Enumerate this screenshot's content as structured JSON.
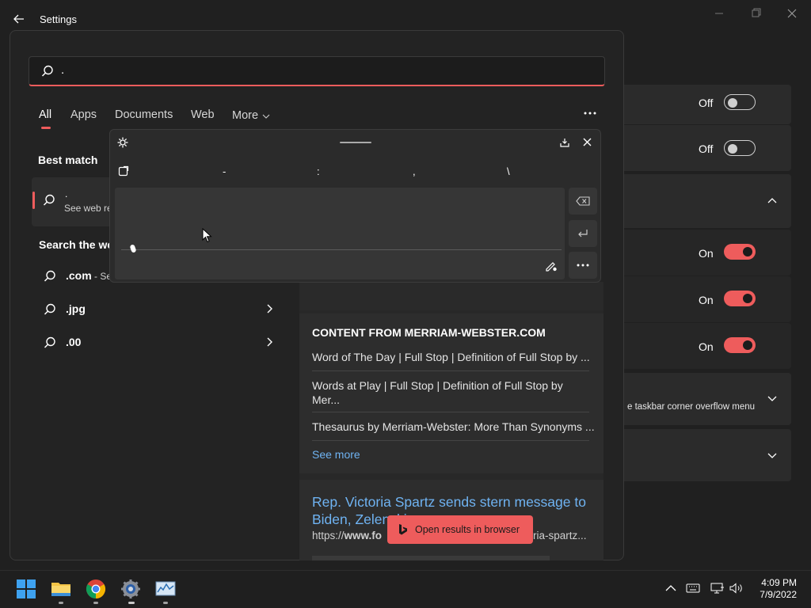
{
  "window": {
    "title": "Settings"
  },
  "settings_rows": [
    {
      "state": "Off"
    },
    {
      "state": "Off"
    },
    {
      "state": "On"
    },
    {
      "state": "On"
    },
    {
      "state": "On"
    },
    {
      "description": "e taskbar corner overflow menu"
    }
  ],
  "search": {
    "query": ".",
    "tabs": [
      "All",
      "Apps",
      "Documents",
      "Web",
      "More"
    ],
    "best_match_heading": "Best match",
    "best_match": {
      "title": ".",
      "subtitle": "See web re"
    },
    "search_web_heading": "Search the we",
    "web_results": [
      {
        "text": ".com",
        "suffix": " - Se"
      },
      {
        "text": ".jpg"
      },
      {
        "text": ".00"
      }
    ]
  },
  "handwriting": {
    "suggestions": [
      "-",
      ":",
      ",",
      "\\"
    ]
  },
  "preview": {
    "content_heading": "CONTENT FROM MERRIAM-WEBSTER.COM",
    "links": [
      "Word of The Day | Full Stop | Definition of Full Stop by ...",
      "Words at Play | Full Stop | Definition of Full Stop by Mer...",
      "Thesaurus by Merriam-Webster: More Than Synonyms ..."
    ],
    "see_more": "See more",
    "news": {
      "title": "Rep. Victoria Spartz sends stern message to Biden, Zelenski",
      "url_prefix": "https://",
      "url_bold": "www.fo",
      "url_tail": "ria-spartz..."
    },
    "open_in_browser": "Open results in browser"
  },
  "taskbar": {
    "time": "4:09 PM",
    "date": "7/9/2022"
  },
  "colors": {
    "accent": "#ee5c5c",
    "link": "#6fb3f2",
    "background": "#202020"
  }
}
